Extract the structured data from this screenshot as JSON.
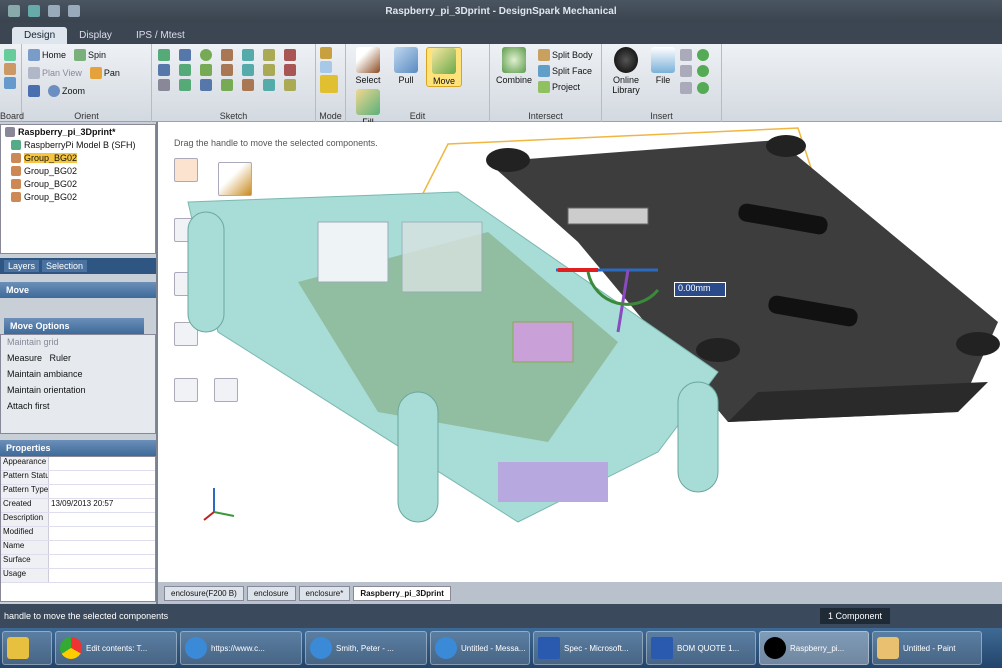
{
  "window": {
    "title": "Raspberry_pi_3Dprint - DesignSpark Mechanical"
  },
  "ribbon_tabs": [
    "Design",
    "Display",
    "IPS / Mtest"
  ],
  "ribbon": {
    "clipboard": {
      "label": "Board"
    },
    "orient": {
      "label": "Orient",
      "items": [
        "Home",
        "Plan View",
        "Zoom",
        "Spin",
        "Pan"
      ]
    },
    "sketch": {
      "label": "Sketch"
    },
    "mode": {
      "label": "Mode"
    },
    "edit": {
      "label": "Edit",
      "items": [
        "Select",
        "Pull",
        "Move",
        "Fill"
      ]
    },
    "intersect": {
      "label": "Intersect",
      "items": [
        "Combine",
        "Split Body",
        "Split Face",
        "Project"
      ]
    },
    "insert": {
      "label": "Insert",
      "items": [
        "Online Library",
        "File"
      ]
    }
  },
  "tree": {
    "items": [
      "Raspberry_pi_3Dprint*",
      "RaspberryPi Model B (SFH)",
      "Group_BG02",
      "Group_BG02",
      "Group_BG02",
      "Group_BG02"
    ]
  },
  "panel_tabs": [
    "Layers",
    "Selection"
  ],
  "move_header": "Move",
  "options": {
    "header": "Move Options",
    "items": [
      "Maintain grid",
      "Measure",
      "Ruler",
      "Maintain ambiance",
      "Maintain orientation",
      "Attach first"
    ]
  },
  "props_header": "Properties",
  "props": [
    {
      "k": "Appearance",
      "v": ""
    },
    {
      "k": "Pattern Status",
      "v": ""
    },
    {
      "k": "Pattern Type",
      "v": ""
    },
    {
      "k": "Created",
      "v": "13/09/2013 20:57"
    },
    {
      "k": "Description",
      "v": ""
    },
    {
      "k": "Modified",
      "v": ""
    },
    {
      "k": "Name",
      "v": ""
    },
    {
      "k": "Surface",
      "v": ""
    },
    {
      "k": "Usage",
      "v": ""
    }
  ],
  "canvas": {
    "hint": "Drag the handle to move the selected components.",
    "measure": "0.00mm"
  },
  "doc_tabs": [
    "enclosure(F200 B)",
    "enclosure",
    "enclosure*",
    "Raspberry_pi_3Dprint"
  ],
  "status": {
    "text": "handle to move the selected components",
    "component": "1 Component"
  },
  "taskbar": [
    "",
    "Edit contents: T...",
    "https://www.c...",
    "Smith, Peter - ...",
    "Untitled - Messa...",
    "Spec - Microsoft...",
    "BOM QUOTE 1...",
    "Raspberry_pi...",
    "Untitled - Paint"
  ],
  "colors": {
    "accent": "#3e6a9a",
    "part": "#a8dcd6",
    "lid": "#3d3d3d",
    "bbox": "#f0b640"
  }
}
